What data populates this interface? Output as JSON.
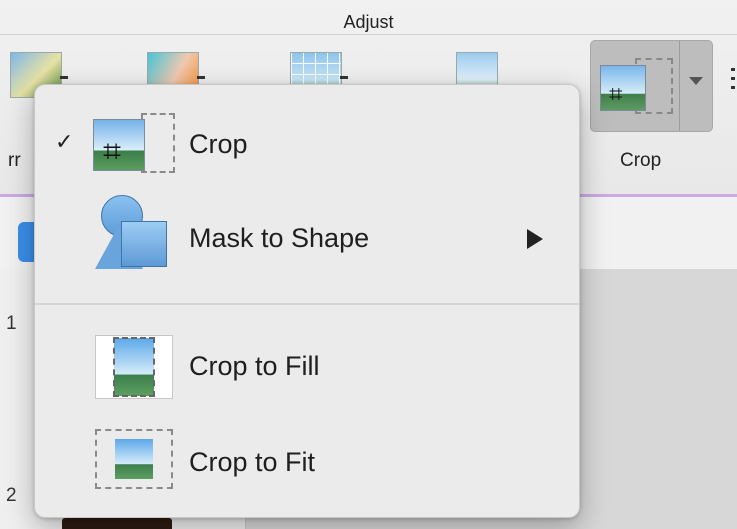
{
  "ribbon": {
    "group_title": "Adjust",
    "left_partial_label": "rr",
    "crop_button_label": "Crop"
  },
  "slides": {
    "numbers": [
      "1",
      "2"
    ]
  },
  "menu": {
    "items": [
      {
        "label": "Crop",
        "checked": true,
        "check_glyph": "✓",
        "icon": "crop-icon"
      },
      {
        "label": "Mask to Shape",
        "has_submenu": true,
        "icon": "mask-to-shape-icon"
      },
      {
        "label": "Crop to Fill",
        "icon": "crop-to-fill-icon"
      },
      {
        "label": "Crop to Fit",
        "icon": "crop-to-fit-icon"
      }
    ]
  },
  "colors": {
    "ribbon_accent": "#c9a9e6",
    "menu_background": "#ebebeb",
    "selection_blue": "#3b8ee9"
  }
}
